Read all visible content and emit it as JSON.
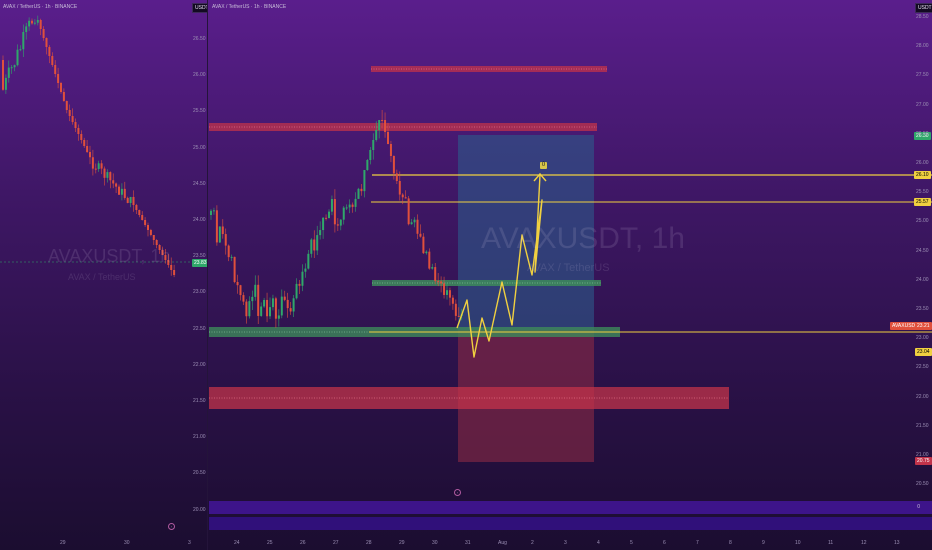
{
  "left_chart": {
    "legend": [
      "AVAX / TetherUS · 1h · BINANCE"
    ],
    "symbol_box": "USDT",
    "price_axis": [
      "26.50",
      "26.00",
      "25.50",
      "25.00",
      "24.50",
      "24.00",
      "23.50",
      "23.00",
      "22.50",
      "22.00",
      "21.50",
      "21.00",
      "20.50",
      "20.00"
    ],
    "time_axis": [
      "29",
      "30",
      "3"
    ],
    "watermark_title": "AVAXUSDT, 1h",
    "watermark_sub": "AVAX / TetherUS",
    "current_price_tag": "23.83"
  },
  "right_chart": {
    "legend": [
      "AVAX / TetherUS · 1h · BINANCE"
    ],
    "symbol_box": "USDT",
    "price_axis": [
      "28.50",
      "28.00",
      "27.50",
      "27.00",
      "26.50",
      "26.00",
      "25.50",
      "25.00",
      "24.50",
      "24.00",
      "23.50",
      "23.00",
      "22.50",
      "22.00",
      "21.50",
      "21.00",
      "20.50"
    ],
    "time_axis": [
      "24",
      "25",
      "26",
      "27",
      "28",
      "29",
      "30",
      "31",
      "Aug",
      "2",
      "3",
      "4",
      "5",
      "6",
      "7",
      "8",
      "9",
      "10",
      "11",
      "12",
      "13"
    ],
    "watermark_title": "AVAXUSDT, 1h",
    "watermark_sub": "AVAX / TetherUS",
    "tags": {
      "level_green_top": "26.30",
      "target_level": "26.10",
      "resistance_level": "25.57",
      "current_label": "AVAXUSDT",
      "current_price": "23.21",
      "current_sub": "23.04",
      "stop_level": "20.75"
    },
    "target_marker": "0",
    "strip_value": "0"
  },
  "colors": {
    "up": "#2fa86a",
    "down": "#e0503c",
    "red_zone": "#c2334a",
    "green_zone": "#3d8a5a",
    "yellow_line": "#f0d040",
    "long_target_zone": "#2d5a8a",
    "long_stop_zone": "#8a2a45"
  }
}
